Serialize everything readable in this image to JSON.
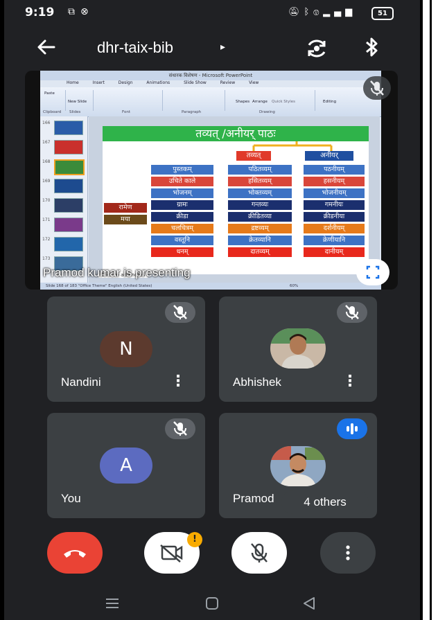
{
  "status_bar": {
    "time": "9:19",
    "left_icons": [
      "cast-icon",
      "vpn-icon"
    ],
    "right_icons": [
      "mute-icon",
      "bluetooth-icon",
      "volte-icon",
      "4g-signal-icon"
    ],
    "battery": "51"
  },
  "top_bar": {
    "meeting_code": "dhr-taix-bib",
    "arrow": "▸"
  },
  "presentation": {
    "caption": "Pramod kumar is presenting",
    "ppt": {
      "window_title": "संधारक विशेषण - Microsoft PowerPoint",
      "tabs": [
        "Home",
        "Insert",
        "Design",
        "Animations",
        "Slide Show",
        "Review",
        "View"
      ],
      "ribbon_groups": [
        "Clipboard",
        "Slides",
        "Font",
        "Paragraph",
        "Drawing",
        "Editing"
      ],
      "ribbon_buttons": [
        "Paste",
        "New Slide",
        "Shapes",
        "Arrange",
        "Quick Styles",
        "Editing"
      ],
      "thumb_numbers": [
        "166",
        "167",
        "168",
        "169",
        "170",
        "171",
        "172",
        "173"
      ],
      "notes_hint": "Click to add notes",
      "status_text": "Slide 168 of 183   \"Office Theme\"   English (United States)",
      "zoom": "60%"
    },
    "slide": {
      "title": "तव्यत् /अनीयर् पाठः",
      "header_a": "तव्यत्",
      "header_b": "अनीयर्",
      "col1": [
        "पुस्तकम्",
        "उचिते काले",
        "भोजनम्",
        "ग्रामः",
        "क्रीडा",
        "चलचित्रम्",
        "वस्तूनि",
        "धनम्"
      ],
      "col2": [
        "पठितव्यम्",
        "हसितव्यम्",
        "भोक्तव्यम्",
        "गन्तव्यः",
        "क्रीडितव्या",
        "द्रष्टव्यम्",
        "क्रेतव्यानि",
        "दातव्यम्"
      ],
      "col3": [
        "पठनीयम्",
        "हसनीयम्",
        "भोजनीयम्",
        "गमनीयः",
        "क्रीडनीया",
        "दर्शनीयम्",
        "क्रेणीयानि",
        "दानीयम्"
      ],
      "side_labels": [
        "रामेण",
        "मया"
      ]
    }
  },
  "participants": [
    {
      "name": "Nandini",
      "initial": "N",
      "avatar_color": "#5c3a2e"
    },
    {
      "name": "Abhishek",
      "initial": "",
      "avatar_color": ""
    },
    {
      "name": "You",
      "initial": "A",
      "avatar_color": "#5c6bc0"
    },
    {
      "name": "Pramod",
      "initial": "",
      "avatar_color": ""
    }
  ],
  "others_label": "4 others",
  "colors": {
    "background": "#202124",
    "tile": "#3c4043",
    "end_call": "#ea4335",
    "speaking": "#1a73e8",
    "badge": "#f9ab00"
  },
  "controls": {
    "end_call": "end-call-icon",
    "camera": "camera-off-icon",
    "mic": "mic-off-icon",
    "more": "more-vert-icon",
    "badge": "!"
  }
}
